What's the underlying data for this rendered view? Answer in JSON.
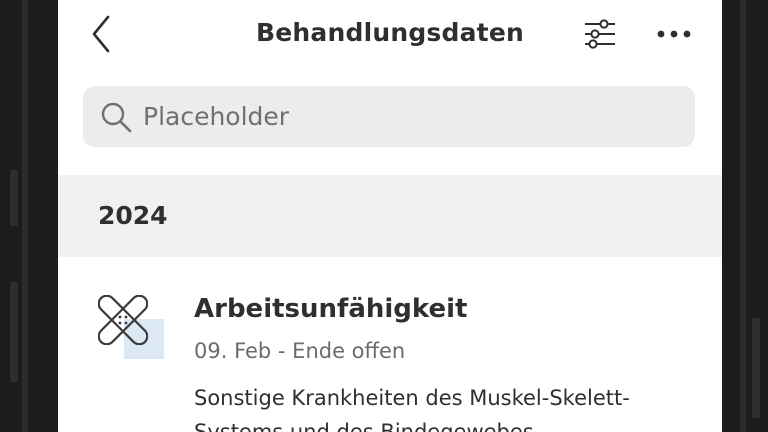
{
  "header": {
    "title": "Behandlungsdaten",
    "back_icon": "chevron-left-icon",
    "filter_icon": "sliders-icon",
    "more_icon": "more-horizontal-icon"
  },
  "search": {
    "placeholder": "Placeholder",
    "value": "",
    "icon": "search-icon"
  },
  "sections": [
    {
      "year": "2024",
      "items": [
        {
          "icon": "bandage-icon",
          "title": "Arbeitsunfähigkeit",
          "date": "09. Feb - Ende offen",
          "description": "Sonstige Krankheiten des Muskel-Skelett-Systems und des Bindegewebes"
        }
      ]
    }
  ],
  "colors": {
    "text_primary": "#2f2f2f",
    "text_secondary": "#6b6b6b",
    "search_background": "#ececec",
    "section_background": "#f0f0f0",
    "icon_highlight": "#dde8f5"
  }
}
